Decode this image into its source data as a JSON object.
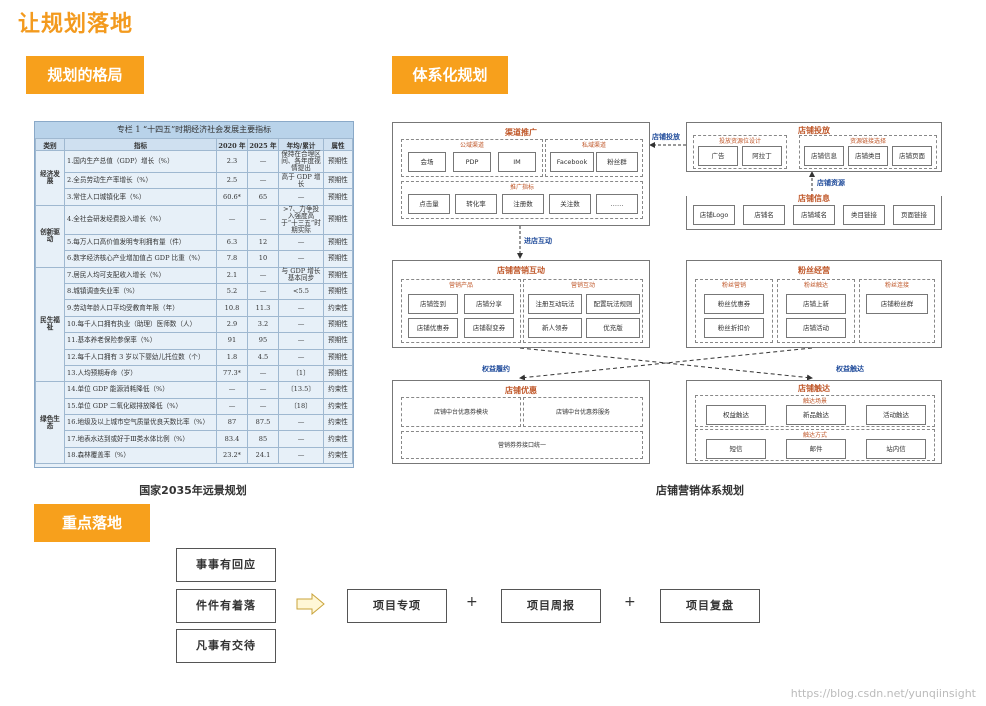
{
  "page_title": "让规划落地",
  "sections": {
    "layout": "规划的格局",
    "system": "体系化规划",
    "focus": "重点落地"
  },
  "table": {
    "title": "专栏 1 “十四五”时期经济社会发展主要指标",
    "headers": [
      "类别",
      "指标",
      "2020 年",
      "2025 年",
      "年均/累计",
      "属性"
    ],
    "groups": [
      {
        "category": "经济发展",
        "rows": [
          {
            "name": "1.国内生产总值（GDP）增长（%）",
            "y2020": "2.3",
            "y2025": "—",
            "avg": "保持在合理区间、各年度视情提出",
            "attr": "预期性"
          },
          {
            "name": "2.全员劳动生产率增长（%）",
            "y2020": "2.5",
            "y2025": "—",
            "avg": "高于 GDP 增长",
            "attr": "预期性"
          },
          {
            "name": "3.常住人口城镇化率（%）",
            "y2020": "60.6*",
            "y2025": "65",
            "avg": "—",
            "attr": "预期性"
          }
        ]
      },
      {
        "category": "创新驱动",
        "rows": [
          {
            "name": "4.全社会研发经费投入增长（%）",
            "y2020": "—",
            "y2025": "—",
            "avg": ">7、力争投入强度高于“十三五”时期实际",
            "attr": "预期性"
          },
          {
            "name": "5.每万人口高价值发明专利拥有量（件）",
            "y2020": "6.3",
            "y2025": "12",
            "avg": "—",
            "attr": "预期性"
          },
          {
            "name": "6.数字经济核心产业增加值占 GDP 比重（%）",
            "y2020": "7.8",
            "y2025": "10",
            "avg": "—",
            "attr": "预期性"
          }
        ]
      },
      {
        "category": "民生福祉",
        "rows": [
          {
            "name": "7.居民人均可支配收入增长（%）",
            "y2020": "2.1",
            "y2025": "—",
            "avg": "与 GDP 增长基本同步",
            "attr": "预期性"
          },
          {
            "name": "8.城镇调查失业率（%）",
            "y2020": "5.2",
            "y2025": "—",
            "avg": "<5.5",
            "attr": "预期性"
          },
          {
            "name": "9.劳动年龄人口平均受教育年限（年）",
            "y2020": "10.8",
            "y2025": "11.3",
            "avg": "—",
            "attr": "约束性"
          },
          {
            "name": "10.每千人口拥有执业（助理）医师数（人）",
            "y2020": "2.9",
            "y2025": "3.2",
            "avg": "—",
            "attr": "预期性"
          },
          {
            "name": "11.基本养老保险参保率（%）",
            "y2020": "91",
            "y2025": "95",
            "avg": "—",
            "attr": "预期性"
          },
          {
            "name": "12.每千人口拥有 3 岁以下婴幼儿托位数（个）",
            "y2020": "1.8",
            "y2025": "4.5",
            "avg": "—",
            "attr": "预期性"
          },
          {
            "name": "13.人均预期寿命（岁）",
            "y2020": "77.3*",
            "y2025": "—",
            "avg": "〔1〕",
            "attr": "预期性"
          }
        ]
      },
      {
        "category": "绿色生态",
        "rows": [
          {
            "name": "14.单位 GDP 能源消耗降低（%）",
            "y2020": "—",
            "y2025": "—",
            "avg": "〔13.5〕",
            "attr": "约束性"
          },
          {
            "name": "15.单位 GDP 二氧化碳排放降低（%）",
            "y2020": "—",
            "y2025": "—",
            "avg": "〔18〕",
            "attr": "约束性"
          },
          {
            "name": "16.地级及以上城市空气质量优良天数比率（%）",
            "y2020": "87",
            "y2025": "87.5",
            "avg": "—",
            "attr": "约束性"
          },
          {
            "name": "17.地表水达到或好于Ⅲ类水体比例（%）",
            "y2020": "83.4",
            "y2025": "85",
            "avg": "—",
            "attr": "约束性"
          },
          {
            "name": "18.森林覆盖率（%）",
            "y2020": "23.2*",
            "y2025": "24.1",
            "avg": "—",
            "attr": "约束性"
          }
        ]
      }
    ],
    "caption": "国家2035年远景规划"
  },
  "diagram": {
    "caption": "店铺营销体系规划",
    "channel": {
      "title": "渠道推广",
      "public_label": "公域渠道",
      "private_label": "私域渠道",
      "public_items": [
        "会场",
        "PDP",
        "IM"
      ],
      "private_items": [
        "Facebook",
        "粉丝群"
      ],
      "metrics_label": "推广指标",
      "metrics": [
        "点击量",
        "转化率",
        "注册数",
        "关注数",
        "……"
      ]
    },
    "shop_delivery": {
      "title": "店铺投放",
      "left_label": "投放资源位设计",
      "right_label": "资源链接选择",
      "left_items": [
        "广告",
        "阿拉丁"
      ],
      "right_items": [
        "店铺信息",
        "店铺类目",
        "店铺页面"
      ]
    },
    "shop_info": {
      "title": "店铺信息",
      "items": [
        "店铺Logo",
        "店铺名",
        "店铺域名",
        "类目链接",
        "页面链接"
      ]
    },
    "interaction": {
      "title": "店铺营销互动",
      "product_label": "营销产品",
      "interact_label": "营销互动",
      "product_items": [
        "店铺签到",
        "店铺分享",
        "店铺优惠券",
        "店铺裂变券"
      ],
      "interact_items": [
        "注册互动玩法",
        "配置玩法规则",
        "新人领券",
        "优充版"
      ]
    },
    "fans": {
      "title": "粉丝经营",
      "marketing_label": "粉丝营销",
      "touch_label": "粉丝触达",
      "link_label": "粉丝连接",
      "marketing_items": [
        "粉丝优惠券",
        "粉丝折扣价"
      ],
      "touch_items": [
        "店铺上新",
        "店铺活动"
      ],
      "link_items": [
        "店铺粉丝群"
      ]
    },
    "optimize": {
      "title": "店铺优惠",
      "items": [
        "店铺中台优惠券模块",
        "店铺中台优惠券服务"
      ],
      "bottom": "营销券券接口统一"
    },
    "reach": {
      "title": "店铺触达",
      "scene_label": "触达场景",
      "method_label": "触达方式",
      "scene_items": [
        "权益触达",
        "新品触达",
        "活动触达"
      ],
      "method_items": [
        "短信",
        "邮件",
        "站内信"
      ]
    },
    "arrows": {
      "shop_delivery": "店铺投放",
      "shop_resource": "店铺资源",
      "enter_interact": "进店互动",
      "benefit_perform": "权益履约",
      "benefit_reach": "权益触达"
    }
  },
  "focus": {
    "left_items": [
      "事事有回应",
      "件件有着落",
      "凡事有交待"
    ],
    "right_items": [
      "项目专项",
      "项目周报",
      "项目复盘"
    ],
    "plus": "+"
  },
  "watermark": "https://blog.csdn.net/yunqiinsight",
  "colors": {
    "accent": "#f7a01c",
    "title": "#f39a1e",
    "diagram_title": "#c0582a",
    "arrow": "#1e4a9a"
  }
}
